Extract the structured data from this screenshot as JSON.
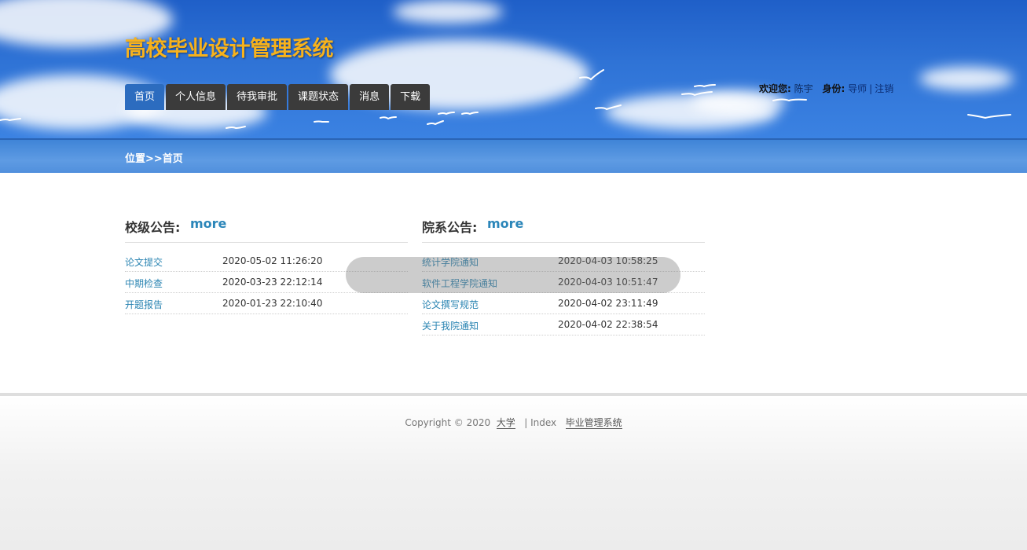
{
  "header": {
    "title": "高校毕业设计管理系统",
    "nav": [
      {
        "label": "首页",
        "active": true
      },
      {
        "label": "个人信息",
        "active": false
      },
      {
        "label": "待我审批",
        "active": false
      },
      {
        "label": "课题状态",
        "active": false
      },
      {
        "label": "消息",
        "active": false
      },
      {
        "label": "下载",
        "active": false
      }
    ],
    "user": {
      "welcome_label": "欢迎您:",
      "name": "陈宇",
      "role_label": "身份:",
      "role": "导师",
      "separator": "|",
      "logout": "注销"
    }
  },
  "breadcrumb": "位置>>首页",
  "school_notices": {
    "title": "校级公告:",
    "more": "more",
    "items": [
      {
        "title": "论文提交",
        "time": "2020-05-02 11:26:20"
      },
      {
        "title": "中期检查",
        "time": "2020-03-23 22:12:14"
      },
      {
        "title": "开题报告",
        "time": "2020-01-23 22:10:40"
      }
    ]
  },
  "dept_notices": {
    "title": "院系公告:",
    "more": "more",
    "items": [
      {
        "title": "统计学院通知",
        "time": "2020-04-03 10:58:25"
      },
      {
        "title": "软件工程学院通知",
        "time": "2020-04-03 10:51:47"
      },
      {
        "title": "论文撰写规范",
        "time": "2020-04-02 23:11:49"
      },
      {
        "title": "关于我院通知",
        "time": "2020-04-02 22:38:54"
      }
    ]
  },
  "footer": {
    "copyright": "Copyright © 2020",
    "school": "大学",
    "index": "| Index",
    "system": "毕业管理系统"
  },
  "colors": {
    "title": "#f7b21c",
    "nav_bg": "#3b3b3b",
    "nav_active": "#2c6cbf",
    "link": "#2a84b2",
    "more": "#2b86b9"
  }
}
